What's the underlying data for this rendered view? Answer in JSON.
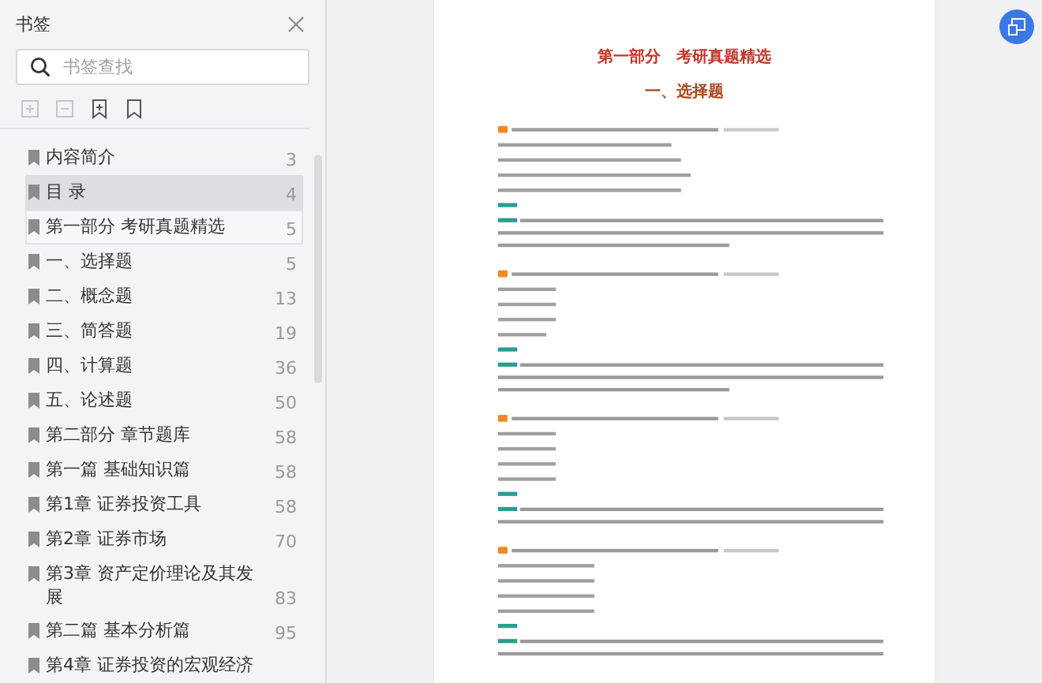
{
  "sidebar": {
    "title": "书签",
    "search": {
      "placeholder": "书签查找"
    },
    "items": [
      {
        "label": "内容简介",
        "page": "3",
        "selected": false,
        "hovered": false
      },
      {
        "label": "目 录",
        "page": "4",
        "selected": true,
        "hovered": false
      },
      {
        "label": "第一部分 考研真题精选",
        "page": "5",
        "selected": false,
        "hovered": true
      },
      {
        "label": "一、选择题",
        "page": "5",
        "selected": false,
        "hovered": false
      },
      {
        "label": "二、概念题",
        "page": "13",
        "selected": false,
        "hovered": false
      },
      {
        "label": "三、简答题",
        "page": "19",
        "selected": false,
        "hovered": false
      },
      {
        "label": "四、计算题",
        "page": "36",
        "selected": false,
        "hovered": false
      },
      {
        "label": "五、论述题",
        "page": "50",
        "selected": false,
        "hovered": false
      },
      {
        "label": "第二部分 章节题库",
        "page": "58",
        "selected": false,
        "hovered": false
      },
      {
        "label": "第一篇 基础知识篇",
        "page": "58",
        "selected": false,
        "hovered": false
      },
      {
        "label": "第1章 证券投资工具",
        "page": "58",
        "selected": false,
        "hovered": false
      },
      {
        "label": "第2章 证券市场",
        "page": "70",
        "selected": false,
        "hovered": false
      },
      {
        "label": "第3章 资产定价理论及其发展",
        "page": "83",
        "selected": false,
        "hovered": false
      },
      {
        "label": "第二篇 基本分析篇",
        "page": "95",
        "selected": false,
        "hovered": false
      },
      {
        "label": "第4章 证券投资的宏观经济",
        "selected": false,
        "hovered": false
      }
    ]
  },
  "document": {
    "part_title": "第一部分　考研真题精选",
    "section_title": "一、选择题"
  }
}
